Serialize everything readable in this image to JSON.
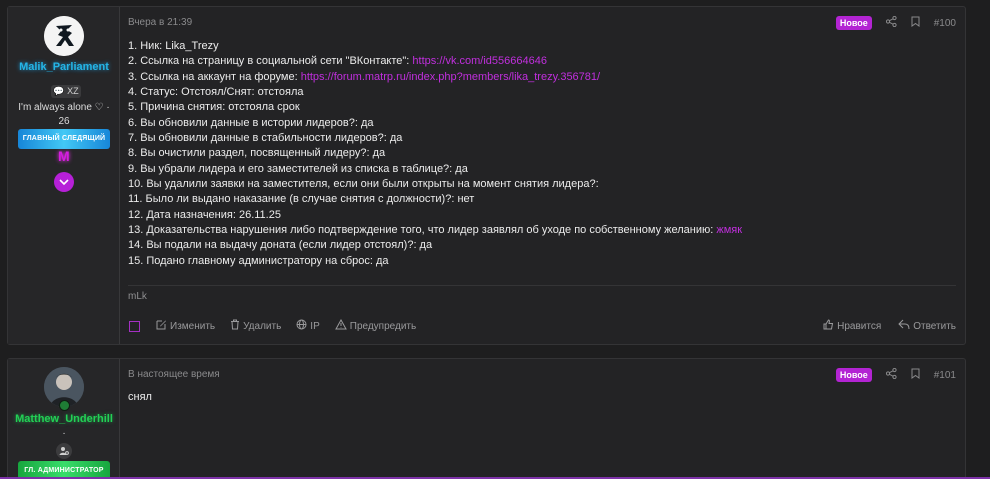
{
  "posts": [
    {
      "user": {
        "name": "Malik_Parliament",
        "tag": "XZ",
        "status": "I'm always alone ♡ ·",
        "count": "26",
        "role": "ГЛАВНЫЙ СЛЕДЯЩИЙ",
        "logo": "M"
      },
      "date": "Вчера в 21:39",
      "new_badge": "Новое",
      "number": "#100",
      "lines": [
        {
          "text": "1. Ник: Lika_Trezy",
          "link": ""
        },
        {
          "text": "2. Ссылка на страницу в социальной сети \"ВКонтакте\": ",
          "link": "https://vk.com/id556664646"
        },
        {
          "text": "3. Ссылка на аккаунт на форуме: ",
          "link": "https://forum.matrp.ru/index.php?members/lika_trezy.356781/"
        },
        {
          "text": "4. Статус: Отстоял/Снят: отстояла",
          "link": ""
        },
        {
          "text": "5. Причина снятия: отстояла срок",
          "link": ""
        },
        {
          "text": "6. Вы обновили данные в истории лидеров?: да",
          "link": ""
        },
        {
          "text": "7. Вы обновили данные в стабильности лидеров?: да",
          "link": ""
        },
        {
          "text": "8. Вы очистили раздел, посвященный лидеру?: да",
          "link": ""
        },
        {
          "text": "9. Вы убрали лидера и его заместителей из списка в таблице?: да",
          "link": ""
        },
        {
          "text": "10. Вы удалили заявки на заместителя, если они были открыты на момент снятия лидера?:",
          "link": ""
        },
        {
          "text": "11. Было ли выдано наказание (в случае снятия с должности)?: нет",
          "link": ""
        },
        {
          "text": "12. Дата назначения: 26.11.25",
          "link": ""
        },
        {
          "text": "13. Доказательства нарушения либо подтверждение того, что лидер заявлял об уходе по собственному желанию: ",
          "link": "жмяк"
        },
        {
          "text": "14. Вы подали на выдачу доната (если лидер отстоял)?: да",
          "link": ""
        },
        {
          "text": "15. Подано главному администратору на сброс: да",
          "link": ""
        }
      ],
      "signature": "mLk",
      "actions": {
        "edit": "Изменить",
        "delete": "Удалить",
        "ip": "IP",
        "warn": "Предупредить",
        "like": "Нравится",
        "reply": "Ответить"
      }
    },
    {
      "user": {
        "name": "Matthew_Underhill",
        "dot": "·",
        "role": "ГЛ. АДМИНИСТРАТОР"
      },
      "date": "В настоящее время",
      "new_badge": "Новое",
      "number": "#101",
      "body": "снял"
    }
  ],
  "colors": {
    "accent": "#b324d3",
    "link": "#c12fde",
    "username1": "#24b5e6",
    "username2": "#22d155"
  }
}
